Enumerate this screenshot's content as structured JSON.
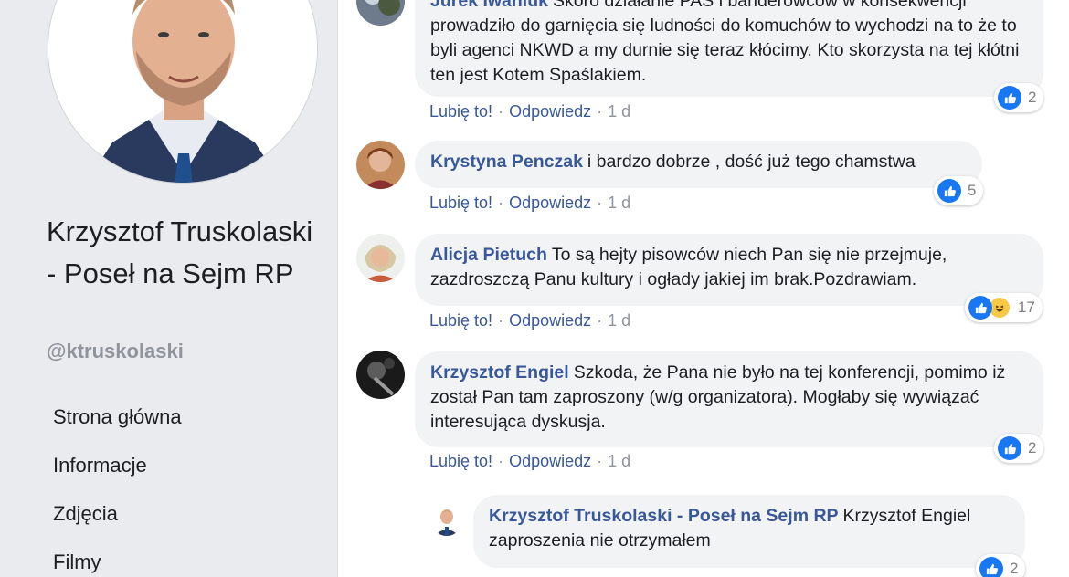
{
  "page": {
    "name": "Krzysztof Truskolaski - Poseł na Sejm RP",
    "handle": "@ktruskolaski",
    "nav": [
      "Strona główna",
      "Informacje",
      "Zdjęcia",
      "Filmy"
    ]
  },
  "actions": {
    "like": "Lubię to!",
    "reply": "Odpowiedz",
    "separator": "·"
  },
  "comments": [
    {
      "author": "Jurek Iwaniuk",
      "text": "Skoro działanie PAS i banderowców w konsekwencji prowadziło do garnięcia się ludności do komuchów to wychodzi na to że to byli agenci NKWD a my durnie się teraz kłócimy. Kto skorzysta na tej kłótni ten jest Kotem Spaślakiem.",
      "time": "1 d",
      "reactions": {
        "icons": [
          "like-icon"
        ],
        "count": "2"
      }
    },
    {
      "author": "Krystyna Penczak",
      "text": "i bardzo dobrze , dość już tego chamstwa",
      "time": "1 d",
      "reactions": {
        "icons": [
          "like-icon"
        ],
        "count": "5"
      }
    },
    {
      "author": "Alicja Pietuch",
      "text": "To są hejty pisowców niech Pan się nie przejmuje, zazdroszczą Panu kultury i ogłady jakiej im brak.Pozdrawiam.",
      "time": "1 d",
      "reactions": {
        "icons": [
          "like-icon",
          "haha-icon"
        ],
        "count": "17"
      }
    },
    {
      "author": "Krzysztof Engiel",
      "text": "Szkoda, że Pana nie było na tej konferencji, pomimo iż został Pan tam zaproszony (w/g organizatora). Mogłaby się wywiązać interesująca dyskusja.",
      "time": "1 d",
      "reactions": {
        "icons": [
          "like-icon"
        ],
        "count": "2"
      }
    }
  ],
  "reply": {
    "author": "Krzysztof Truskolaski - Poseł na Sejm RP",
    "text": "Krzysztof Engiel zaproszenia nie otrzymałem",
    "reactions": {
      "icons": [
        "like-icon"
      ],
      "count": "2"
    }
  },
  "colors": {
    "link": "#385898",
    "bubble": "#f2f3f5",
    "sidebar": "#e9ebee",
    "like": "#1877f2"
  }
}
